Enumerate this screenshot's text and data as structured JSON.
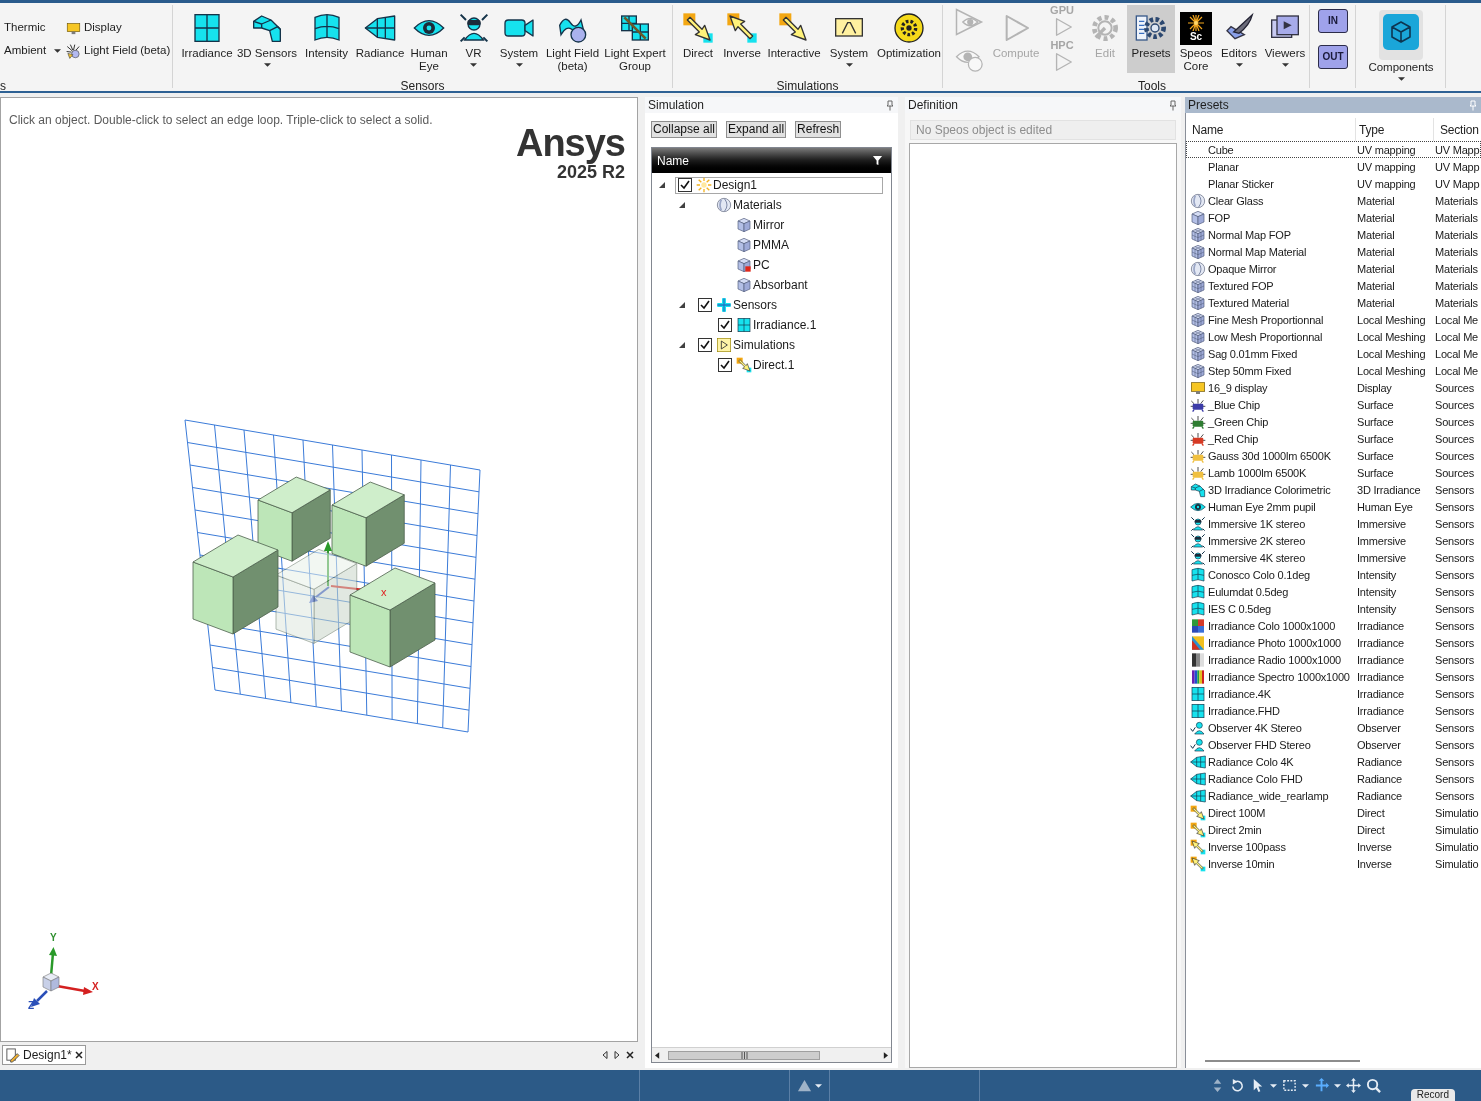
{
  "ribbon": {
    "groups": [
      {
        "label": "s",
        "kind": "small",
        "buttons": [
          {
            "label": "Thermic",
            "kind": "none",
            "dropdown": false
          },
          {
            "label": "Display",
            "kind": "display",
            "dropdown": false
          },
          {
            "label": "Ambient",
            "kind": "none",
            "dropdown": true
          },
          {
            "label": "Light Field (beta)",
            "kind": "lightfield",
            "dropdown": false
          }
        ]
      },
      {
        "label": "Sensors",
        "kind": "large",
        "buttons": [
          {
            "label": "Irradiance",
            "kind": "irradiance",
            "dropdown": false
          },
          {
            "label": "3D Sensors",
            "kind": "sensor3d",
            "dropdown": true
          },
          {
            "label": "Intensity",
            "kind": "intensity",
            "dropdown": false
          },
          {
            "label": "Radiance",
            "kind": "radiance",
            "dropdown": false
          },
          {
            "label": "Human Eye",
            "kind": "eye",
            "dropdown": false
          },
          {
            "label": "VR",
            "kind": "vr",
            "dropdown": true
          },
          {
            "label": "System",
            "kind": "camera",
            "dropdown": true
          },
          {
            "label": "Light Field (beta)",
            "kind": "wave",
            "dropdown": false
          },
          {
            "label": "Light Expert Group",
            "kind": "panels",
            "dropdown": false
          }
        ]
      },
      {
        "label": "Simulations",
        "kind": "large",
        "buttons": [
          {
            "label": "Direct",
            "kind": "direct",
            "dropdown": false
          },
          {
            "label": "Inverse",
            "kind": "inverse",
            "dropdown": false
          },
          {
            "label": "Interactive",
            "kind": "interactive",
            "dropdown": false
          },
          {
            "label": "System",
            "kind": "screen",
            "dropdown": true
          },
          {
            "label": "Optimization",
            "kind": "optimization",
            "dropdown": false
          }
        ]
      },
      {
        "label": "Tools",
        "kind": "large",
        "buttons": [
          {
            "kind": "eyes",
            "dropdown": false,
            "disabled": true,
            "selected": false
          },
          {
            "label": "Compute",
            "kind": "play",
            "dropdown": false,
            "disabled": true,
            "selected": false
          },
          {
            "kind": "stack",
            "labels": [
              "GPU",
              "HPC"
            ],
            "dropdown": false,
            "disabled": true,
            "selected": false
          },
          {
            "label": "Edit",
            "kind": "edit",
            "dropdown": false,
            "disabled": true,
            "selected": false
          },
          {
            "label": "Presets",
            "kind": "presets",
            "dropdown": false,
            "disabled": false,
            "selected": true
          },
          {
            "label": "Speos Core",
            "kind": "speos",
            "icon_text": "Sc",
            "dropdown": false,
            "disabled": false,
            "selected": false
          },
          {
            "label": "Editors",
            "kind": "editors",
            "dropdown": true,
            "disabled": false,
            "selected": false
          },
          {
            "label": "Viewers",
            "kind": "viewers",
            "dropdown": true,
            "disabled": false,
            "selected": false
          }
        ]
      },
      {
        "kind": "large",
        "buttons": [
          {
            "kind": "folders",
            "labels": [
              "IN",
              "OUT"
            ]
          }
        ]
      },
      {
        "kind": "large",
        "buttons": [
          {
            "label": "Components",
            "kind": "components",
            "dropdown": true
          }
        ]
      }
    ]
  },
  "viewport": {
    "hint": "Click an object. Double-click to select an edge loop. Triple-click to select a solid.",
    "logo": {
      "name": "Ansys",
      "version": "2025 R2"
    },
    "scene_labels": [
      "x"
    ],
    "triad": [
      {
        "label": "Y",
        "color": "#2f8f2f"
      },
      {
        "label": "X",
        "color": "#d42020"
      },
      {
        "label": "Z",
        "color": "#2a4fb8"
      }
    ],
    "tabs": [
      {
        "label": "Design1*",
        "selected": true
      }
    ]
  },
  "simulation": {
    "title": "Simulation",
    "buttons": [
      "Collapse all",
      "Expand all",
      "Refresh"
    ],
    "tree": {
      "column": "Name",
      "nodes": [
        {
          "label": "Design1",
          "kind": "sun",
          "checked": true,
          "expanded": true,
          "selected": true,
          "children": [
            {
              "label": "Materials",
              "kind": "sphere",
              "expanded": true,
              "selected": false,
              "children": [
                {
                  "label": "Mirror",
                  "kind": "cube",
                  "selected": false
                },
                {
                  "label": "PMMA",
                  "kind": "cube",
                  "selected": false
                },
                {
                  "label": "PC",
                  "kind": "cubemark",
                  "selected": false
                },
                {
                  "label": "Absorbant",
                  "kind": "cube",
                  "selected": false
                }
              ]
            },
            {
              "label": "Sensors",
              "kind": "cross",
              "checked": true,
              "expanded": true,
              "selected": false,
              "children": [
                {
                  "label": "Irradiance.1",
                  "kind": "irradiance",
                  "checked": true,
                  "selected": false
                }
              ]
            },
            {
              "label": "Simulations",
              "kind": "simfolder",
              "checked": true,
              "expanded": true,
              "selected": false,
              "children": [
                {
                  "label": "Direct.1",
                  "kind": "direct",
                  "checked": true,
                  "selected": false
                }
              ]
            }
          ]
        }
      ]
    }
  },
  "definition": {
    "title": "Definition",
    "message": "No Speos object is edited"
  },
  "presets": {
    "title": "Presets",
    "columns": [
      "Name",
      "Type",
      "Section"
    ],
    "rows": [
      {
        "name": "Cube",
        "type": "UV mapping",
        "section": "UV Mapp",
        "kind": "none",
        "selected": true
      },
      {
        "name": "Planar",
        "type": "UV mapping",
        "section": "UV Mapp",
        "kind": "none",
        "selected": false
      },
      {
        "name": "Planar Sticker",
        "type": "UV mapping",
        "section": "UV Mapp",
        "kind": "none",
        "selected": false
      },
      {
        "name": "Clear Glass",
        "type": "Material",
        "section": "Materials",
        "kind": "sphere",
        "selected": false
      },
      {
        "name": "FOP",
        "type": "Material",
        "section": "Materials",
        "kind": "cube",
        "selected": false
      },
      {
        "name": "Normal Map FOP",
        "type": "Material",
        "section": "Materials",
        "kind": "mesh",
        "selected": false
      },
      {
        "name": "Normal Map Material",
        "type": "Material",
        "section": "Materials",
        "kind": "mesh",
        "selected": false
      },
      {
        "name": "Opaque Mirror",
        "type": "Material",
        "section": "Materials",
        "kind": "sphere",
        "selected": false
      },
      {
        "name": "Textured FOP",
        "type": "Material",
        "section": "Materials",
        "kind": "mesh",
        "selected": false
      },
      {
        "name": "Textured Material",
        "type": "Material",
        "section": "Materials",
        "kind": "mesh",
        "selected": false
      },
      {
        "name": "Fine Mesh Proportionnal",
        "type": "Local Meshing",
        "section": "Local Me",
        "kind": "mesh",
        "selected": false
      },
      {
        "name": "Low Mesh Proportionnal",
        "type": "Local Meshing",
        "section": "Local Me",
        "kind": "mesh",
        "selected": false
      },
      {
        "name": "Sag 0.01mm Fixed",
        "type": "Local Meshing",
        "section": "Local Me",
        "kind": "mesh",
        "selected": false
      },
      {
        "name": "Step 50mm Fixed",
        "type": "Local Meshing",
        "section": "Local Me",
        "kind": "mesh",
        "selected": false
      },
      {
        "name": "16_9 display",
        "type": "Display",
        "section": "Sources",
        "kind": "display",
        "selected": false
      },
      {
        "name": "_Blue Chip",
        "type": "Surface",
        "section": "Sources",
        "kind": "chip",
        "color": "#3c3ca8",
        "selected": false
      },
      {
        "name": "_Green Chip",
        "type": "Surface",
        "section": "Sources",
        "kind": "chip",
        "color": "#2e7d32",
        "selected": false
      },
      {
        "name": "_Red Chip",
        "type": "Surface",
        "section": "Sources",
        "kind": "chip",
        "color": "#d63a24",
        "selected": false
      },
      {
        "name": "Gauss 30d 1000lm 6500K",
        "type": "Surface",
        "section": "Sources",
        "kind": "chip",
        "color": "#f0c040",
        "selected": false
      },
      {
        "name": "Lamb 1000lm 6500K",
        "type": "Surface",
        "section": "Sources",
        "kind": "chip",
        "color": "#f0c040",
        "selected": false
      },
      {
        "name": "3D Irradiance Colorimetric",
        "type": "3D Irradiance",
        "section": "Sensors",
        "kind": "sensor3d",
        "selected": false
      },
      {
        "name": "Human Eye 2mm pupil",
        "type": "Human Eye",
        "section": "Sensors",
        "kind": "eye",
        "selected": false
      },
      {
        "name": "Immersive 1K stereo",
        "type": "Immersive",
        "section": "Sensors",
        "kind": "vr",
        "selected": false
      },
      {
        "name": "Immersive 2K stereo",
        "type": "Immersive",
        "section": "Sensors",
        "kind": "vr",
        "selected": false
      },
      {
        "name": "Immersive 4K stereo",
        "type": "Immersive",
        "section": "Sensors",
        "kind": "vr",
        "selected": false
      },
      {
        "name": "Conosco Colo 0.1deg",
        "type": "Intensity",
        "section": "Sensors",
        "kind": "intensity",
        "selected": false
      },
      {
        "name": "Eulumdat 0.5deg",
        "type": "Intensity",
        "section": "Sensors",
        "kind": "intensity",
        "selected": false
      },
      {
        "name": "IES C 0.5deg",
        "type": "Intensity",
        "section": "Sensors",
        "kind": "intensity",
        "selected": false
      },
      {
        "name": "Irradiance Colo 1000x1000",
        "type": "Irradiance",
        "section": "Sensors",
        "kind": "colo",
        "selected": false
      },
      {
        "name": "Irradiance Photo 1000x1000",
        "type": "Irradiance",
        "section": "Sensors",
        "kind": "photo",
        "selected": false
      },
      {
        "name": "Irradiance Radio 1000x1000",
        "type": "Irradiance",
        "section": "Sensors",
        "kind": "radio",
        "selected": false
      },
      {
        "name": "Irradiance Spectro 1000x1000",
        "type": "Irradiance",
        "section": "Sensors",
        "kind": "spectro",
        "selected": false
      },
      {
        "name": "Irradiance.4K",
        "type": "Irradiance",
        "section": "Sensors",
        "kind": "irradiance",
        "selected": false
      },
      {
        "name": "Irradiance.FHD",
        "type": "Irradiance",
        "section": "Sensors",
        "kind": "irradiance",
        "selected": false
      },
      {
        "name": "Observer 4K Stereo",
        "type": "Observer",
        "section": "Sensors",
        "kind": "observer",
        "selected": false
      },
      {
        "name": "Observer FHD Stereo",
        "type": "Observer",
        "section": "Sensors",
        "kind": "observer",
        "selected": false
      },
      {
        "name": "Radiance Colo 4K",
        "type": "Radiance",
        "section": "Sensors",
        "kind": "radiance",
        "selected": false
      },
      {
        "name": "Radiance Colo FHD",
        "type": "Radiance",
        "section": "Sensors",
        "kind": "radiance",
        "selected": false
      },
      {
        "name": "Radiance_wide_rearlamp",
        "type": "Radiance",
        "section": "Sensors",
        "kind": "radiance",
        "selected": false
      },
      {
        "name": "Direct 100M",
        "type": "Direct",
        "section": "Simulatio",
        "kind": "direct",
        "selected": false
      },
      {
        "name": "Direct 2min",
        "type": "Direct",
        "section": "Simulatio",
        "kind": "direct",
        "selected": false
      },
      {
        "name": "Inverse 100pass",
        "type": "Inverse",
        "section": "Simulatio",
        "kind": "inverse",
        "selected": false
      },
      {
        "name": "Inverse 10min",
        "type": "Inverse",
        "section": "Simulatio",
        "kind": "inverse",
        "selected": false
      }
    ]
  },
  "status_bar": {
    "tooltip": "Record"
  }
}
